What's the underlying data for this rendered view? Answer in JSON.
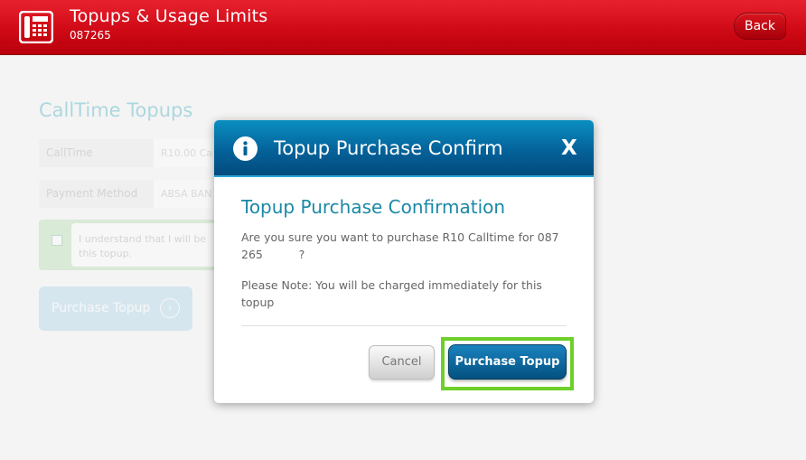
{
  "header": {
    "title": "Topups & Usage Limits",
    "subtitle": "087265",
    "back_label": "Back",
    "icon": "desk-phone-icon"
  },
  "background_page": {
    "heading": "CallTime Topups",
    "rows": [
      {
        "label": "CallTime",
        "value": "R10.00 Ca"
      },
      {
        "label": "Payment Method",
        "value": "ABSA BAN"
      }
    ],
    "checkbox_text_line1": "I understand that I will be",
    "checkbox_text_line2": "this topup.",
    "purchase_label": "Purchase Topup"
  },
  "modal": {
    "title": "Topup Purchase Confirm",
    "close_label": "X",
    "heading": "Topup Purchase Confirmation",
    "question_line1": "Are you sure you want to purchase R10 Calltime for 087",
    "question_line2": "265          ?",
    "note_line1": "Please Note: You will be charged immediately for this",
    "note_line2": "topup",
    "cancel_label": "Cancel",
    "purchase_label": "Purchase Topup"
  },
  "colors": {
    "header_red": "#cf0a16",
    "modal_blue": "#04629a",
    "heading_teal": "#1a89a6",
    "highlight_green": "#6fcf2a"
  }
}
